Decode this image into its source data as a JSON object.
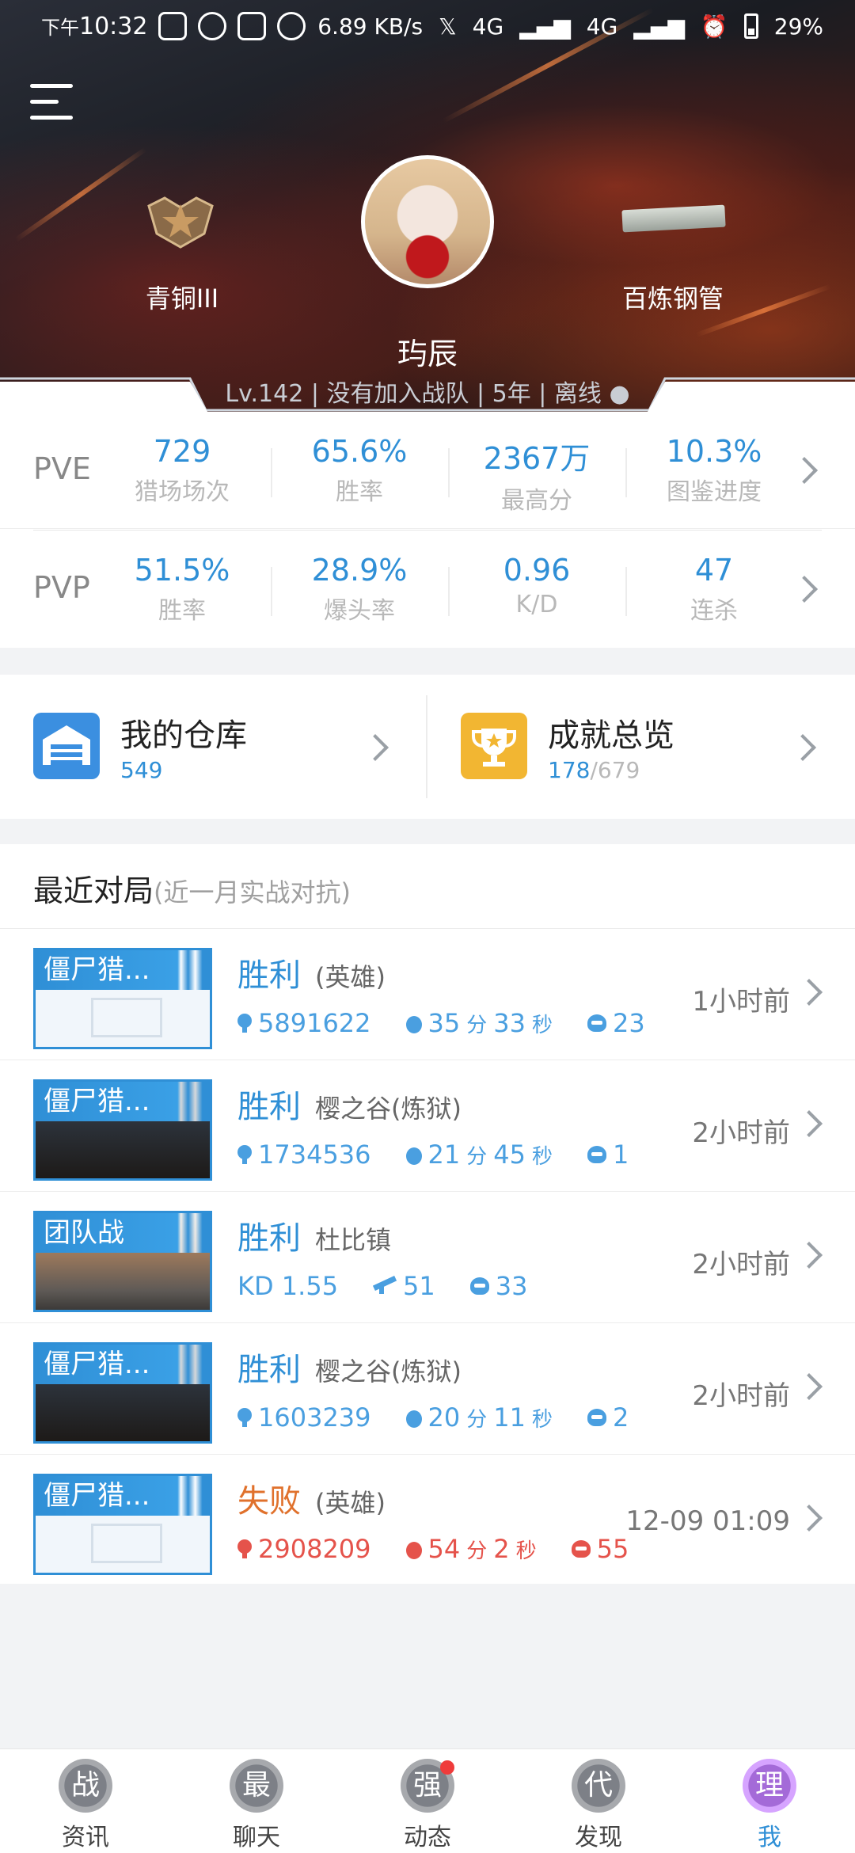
{
  "status_bar": {
    "time_prefix": "下午",
    "time": "10:32",
    "speed": "6.89 KB/s",
    "net1": "4G",
    "net2": "4G",
    "battery": "29%"
  },
  "profile": {
    "rank_label": "青铜III",
    "weapon_label": "百炼钢管",
    "name": "玙辰",
    "meta": "Lv.142 | 没有加入战队 | 5年 |  离线 ●"
  },
  "stats": {
    "pve": {
      "mode": "PVE",
      "cells": [
        {
          "value": "729",
          "label": "猎场场次"
        },
        {
          "value": "65.6%",
          "label": "胜率"
        },
        {
          "value": "2367万",
          "label": "最高分"
        },
        {
          "value": "10.3%",
          "label": "图鉴进度"
        }
      ]
    },
    "pvp": {
      "mode": "PVP",
      "cells": [
        {
          "value": "51.5%",
          "label": "胜率"
        },
        {
          "value": "28.9%",
          "label": "爆头率"
        },
        {
          "value": "0.96",
          "label": "K/D"
        },
        {
          "value": "47",
          "label": "连杀"
        }
      ]
    }
  },
  "shortcuts": {
    "warehouse": {
      "title": "我的仓库",
      "count": "549"
    },
    "achievements": {
      "title": "成就总览",
      "done": "178",
      "total": "/679"
    }
  },
  "recent": {
    "title": "最近对局",
    "subtitle": "(近一月实战对抗)",
    "matches": [
      {
        "tag": "僵尸猎...",
        "result": "胜利",
        "map": "(英雄)",
        "s1": "5891622",
        "s2_min": "35",
        "s2_min_u": "分",
        "s2_sec": "33",
        "s2_sec_u": "秒",
        "s3": "23",
        "time": "1小时前"
      },
      {
        "tag": "僵尸猎...",
        "result": "胜利",
        "map": "樱之谷(炼狱)",
        "s1": "1734536",
        "s2_min": "21",
        "s2_min_u": "分",
        "s2_sec": "45",
        "s2_sec_u": "秒",
        "s3": "1",
        "time": "2小时前"
      },
      {
        "tag": "团队战",
        "result": "胜利",
        "map": "杜比镇",
        "kd": "KD 1.55",
        "kills": "51",
        "heads": "33",
        "time": "2小时前"
      },
      {
        "tag": "僵尸猎...",
        "result": "胜利",
        "map": "樱之谷(炼狱)",
        "s1": "1603239",
        "s2_min": "20",
        "s2_min_u": "分",
        "s2_sec": "11",
        "s2_sec_u": "秒",
        "s3": "2",
        "time": "2小时前"
      },
      {
        "tag": "僵尸猎...",
        "result": "失败",
        "map": "(英雄)",
        "s1": "2908209",
        "s2_min": "54",
        "s2_min_u": "分",
        "s2_sec": "2",
        "s2_sec_u": "秒",
        "s3": "55",
        "time": "12-09 01:09"
      }
    ]
  },
  "nav": {
    "items": [
      {
        "glyph": "战",
        "label": "资讯"
      },
      {
        "glyph": "最",
        "label": "聊天"
      },
      {
        "glyph": "强",
        "label": "动态"
      },
      {
        "glyph": "代",
        "label": "发现"
      },
      {
        "glyph": "理",
        "label": "我"
      }
    ]
  },
  "colors": {
    "accent": "#2f8fd6",
    "lose": "#e0712c",
    "lose_stats": "#e5534b",
    "active_nav": "#a46ad8"
  }
}
